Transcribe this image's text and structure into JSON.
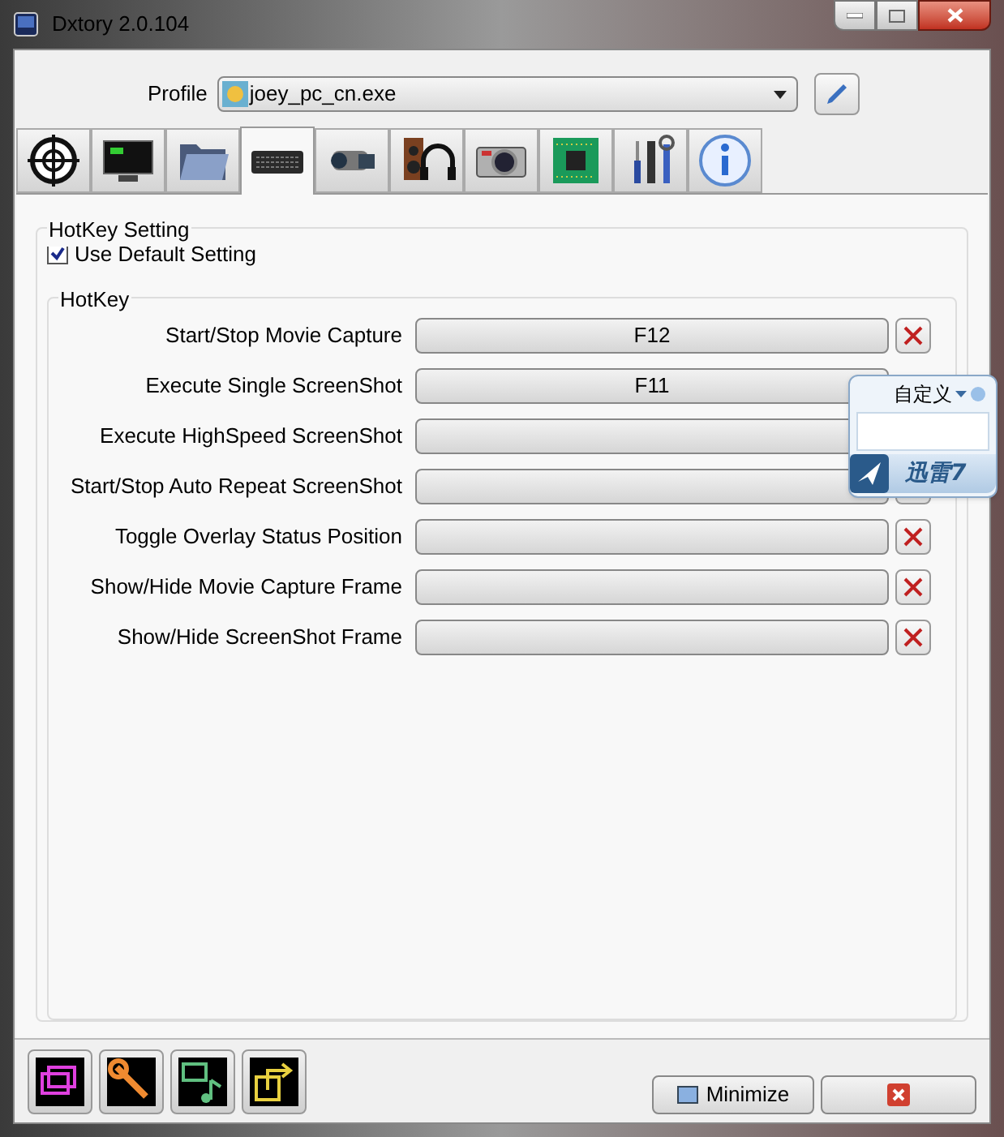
{
  "window": {
    "title": "Dxtory 2.0.104"
  },
  "profile": {
    "label": "Profile",
    "value": "joey_pc_cn.exe"
  },
  "tabs": [
    {
      "kind": "crosshair",
      "selected": false
    },
    {
      "kind": "monitor",
      "selected": false
    },
    {
      "kind": "folder",
      "selected": false
    },
    {
      "kind": "keyboard",
      "selected": true
    },
    {
      "kind": "camcorder",
      "selected": false
    },
    {
      "kind": "audio",
      "selected": false
    },
    {
      "kind": "camera",
      "selected": false
    },
    {
      "kind": "chip",
      "selected": false
    },
    {
      "kind": "tools",
      "selected": false
    },
    {
      "kind": "info",
      "selected": false
    }
  ],
  "hotkey_setting": {
    "title": "HotKey Setting",
    "use_default": {
      "label": "Use Default Setting",
      "checked": true
    },
    "hotkey": {
      "title": "HotKey",
      "rows": [
        {
          "label": "Start/Stop Movie Capture",
          "key": "F12"
        },
        {
          "label": "Execute Single ScreenShot",
          "key": "F11",
          "clear_button": false
        },
        {
          "label": "Execute HighSpeed ScreenShot",
          "key": "",
          "clear_button": false
        },
        {
          "label": "Start/Stop Auto Repeat ScreenShot",
          "key": ""
        },
        {
          "label": "Toggle Overlay Status Position",
          "key": ""
        },
        {
          "label": "Show/Hide Movie Capture Frame",
          "key": ""
        },
        {
          "label": "Show/Hide ScreenShot Frame",
          "key": ""
        }
      ]
    }
  },
  "bottom_tools": [
    {
      "kind": "windows",
      "color": "#e040e0"
    },
    {
      "kind": "wrench",
      "color": "#f08a30"
    },
    {
      "kind": "media",
      "color": "#60c080"
    },
    {
      "kind": "export",
      "color": "#e8d040"
    }
  ],
  "minimize_button": {
    "label": "Minimize"
  },
  "floating_widget": {
    "title": "自定义",
    "brand": "迅雷7"
  }
}
